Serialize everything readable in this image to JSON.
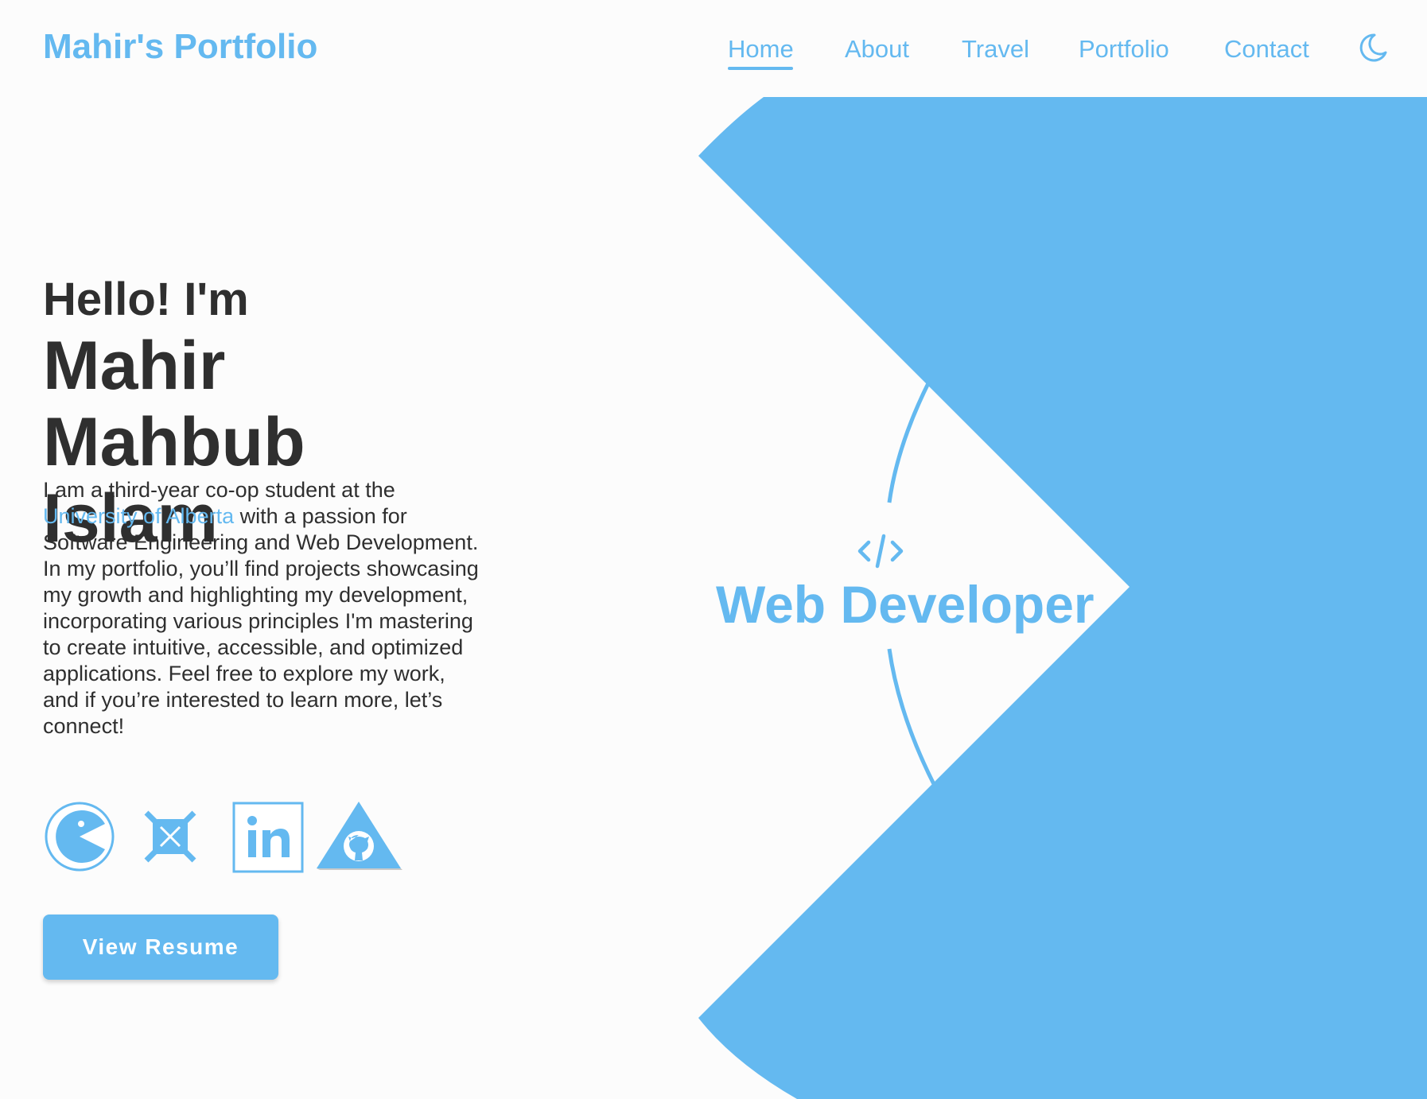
{
  "header": {
    "brand": "Mahir's Portfolio",
    "nav": [
      {
        "label": "Home",
        "active": true
      },
      {
        "label": "About",
        "active": false
      },
      {
        "label": "Travel",
        "active": false
      },
      {
        "label": "Portfolio",
        "active": false
      },
      {
        "label": "Contact",
        "active": false
      }
    ],
    "theme_toggle_icon": "moon-icon"
  },
  "hero": {
    "greeting": "Hello! I'm",
    "name": "Mahir Mahbub Islam",
    "bio_before_link": "I am a third-year co-op student at the ",
    "bio_link": "University of Alberta",
    "bio_after_link": " with a passion for Software Engineering and Web Development. In my portfolio, you’ll find projects showcasing my growth and highlighting my development, incorporating various principles I'm mastering to create intuitive, accessible, and optimized applications. Feel free to explore my work, and if you’re interested to learn more, let’s connect!",
    "socials": [
      {
        "icon": "pacman-icon"
      },
      {
        "icon": "x-social-icon"
      },
      {
        "icon": "linkedin-icon"
      },
      {
        "icon": "github-icon"
      }
    ],
    "resume_button": "View Resume"
  },
  "role": {
    "icon": "code-icon",
    "title": "Web Developer"
  },
  "colors": {
    "accent": "#64b9f0",
    "text": "#2f2f2f",
    "background": "#fcfcfc"
  }
}
